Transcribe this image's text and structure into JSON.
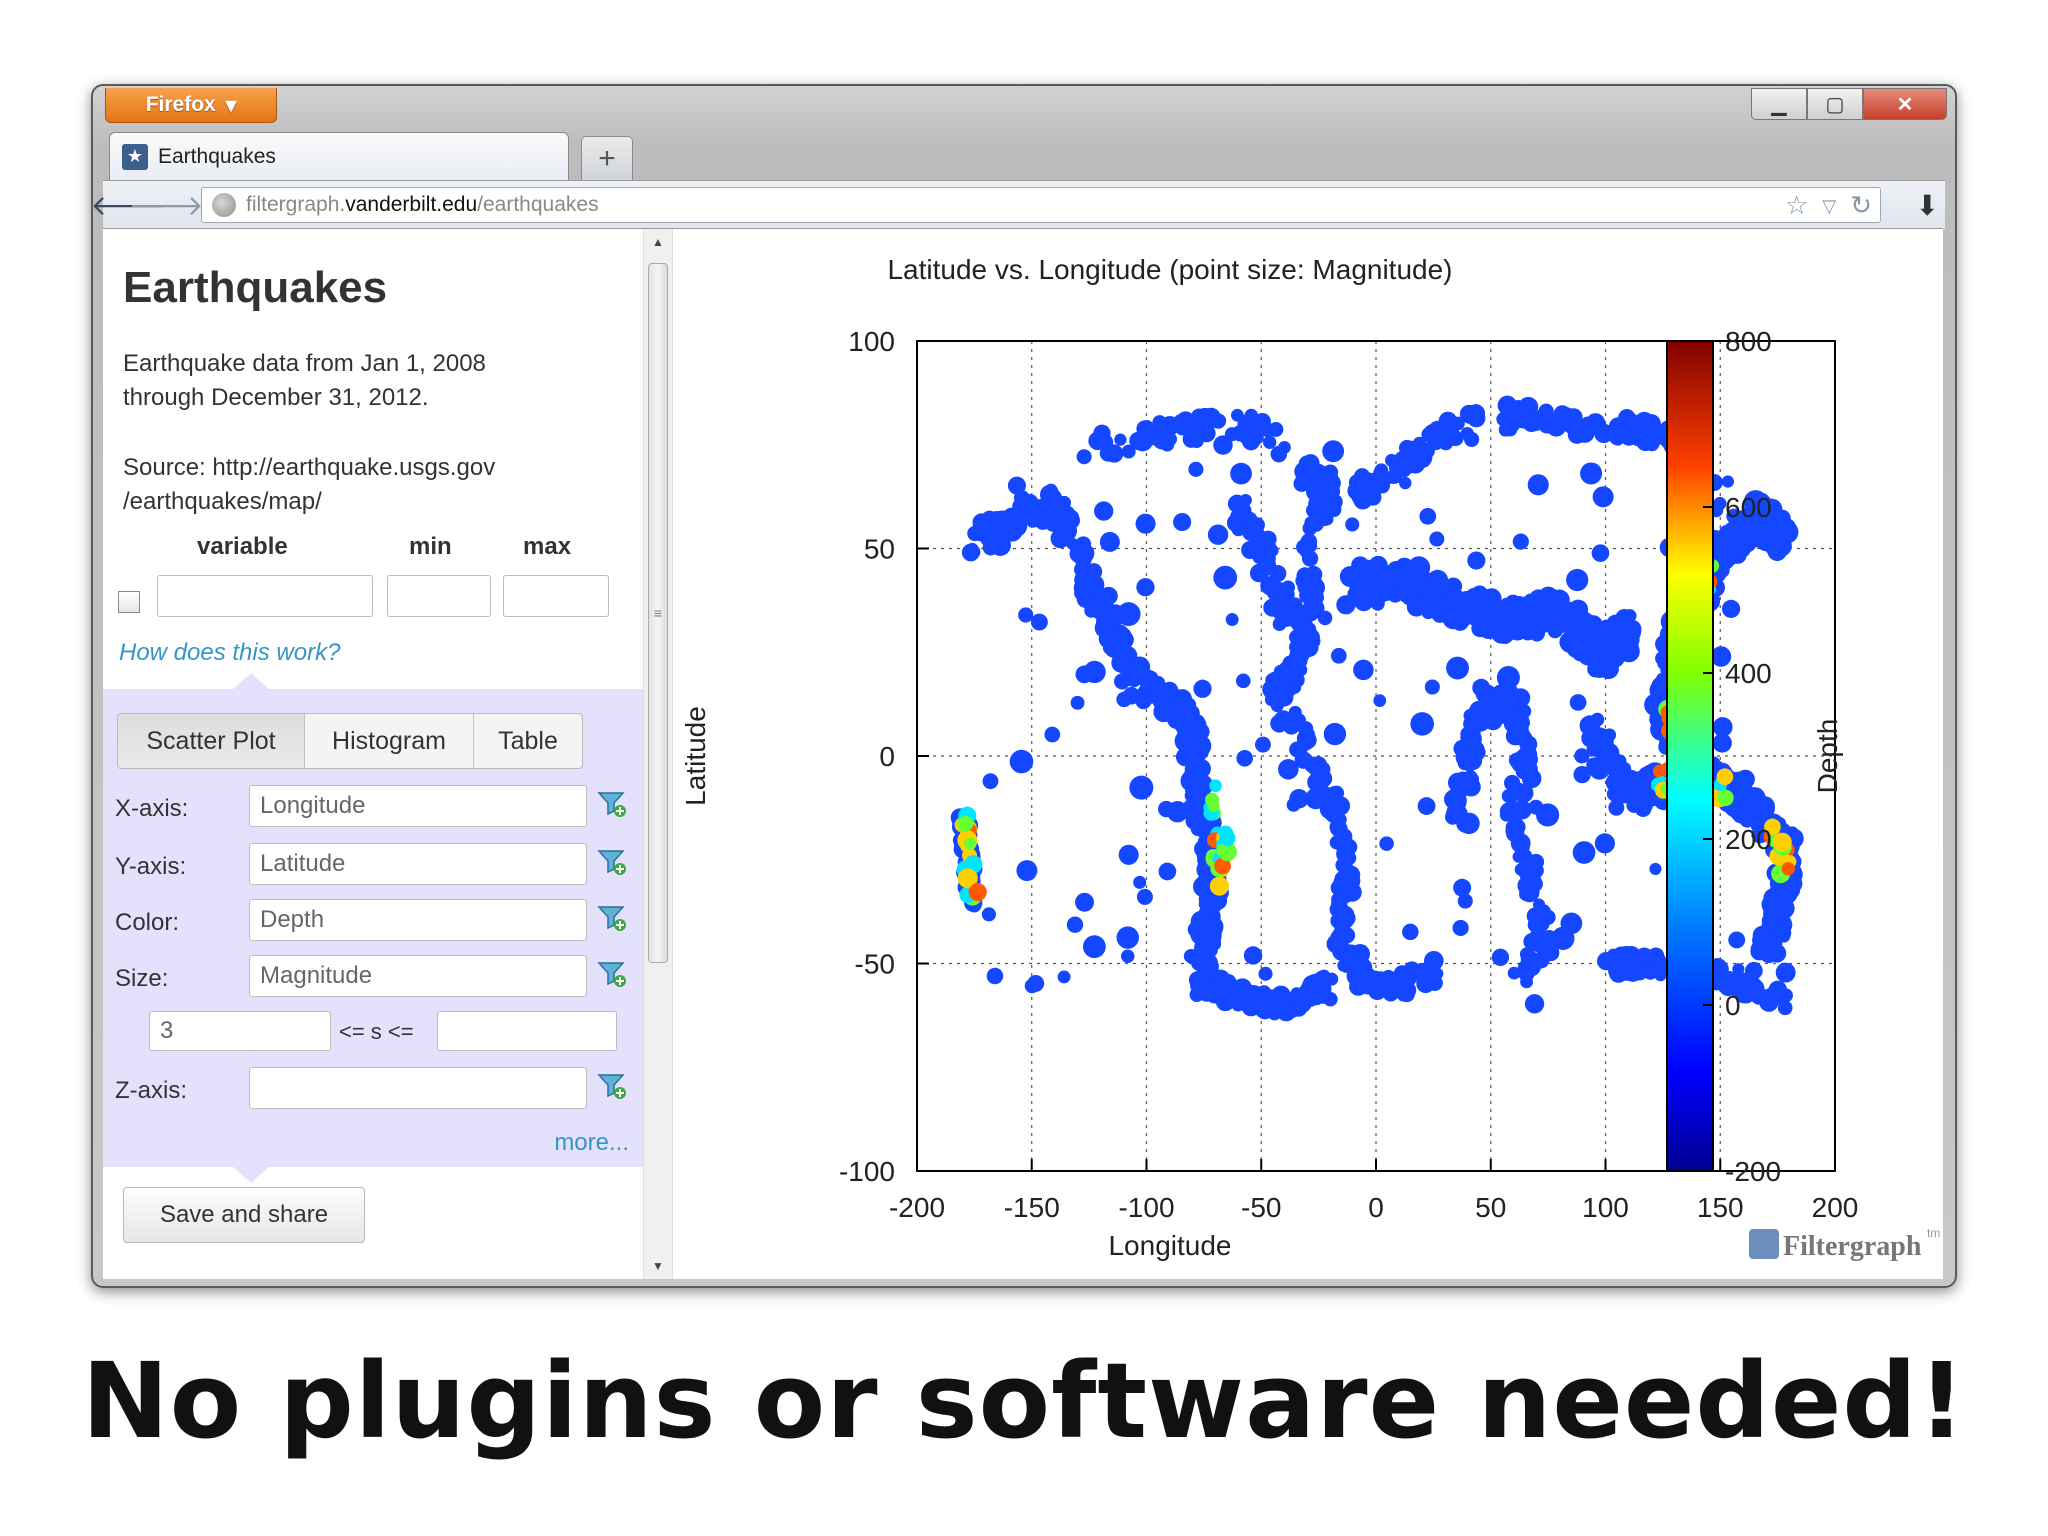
{
  "browser": {
    "app_button": "Firefox",
    "tab_title": "Earthquakes",
    "new_tab": "+",
    "url": {
      "host": "filtergraph.",
      "domain": "vanderbilt.edu",
      "path": "/earthquakes"
    },
    "window_controls": [
      "▁",
      "▢",
      "✕"
    ]
  },
  "sidebar": {
    "title": "Earthquakes",
    "description_line1": "Earthquake data from Jan 1, 2008",
    "description_line2": "through December 31, 2012.",
    "source_line1": "Source: http://earthquake.usgs.gov",
    "source_line2": "/earthquakes/map/",
    "filter_headers": {
      "variable": "variable",
      "min": "min",
      "max": "max"
    },
    "help_link": "How does this work?",
    "tabs": [
      "Scatter Plot",
      "Histogram",
      "Table"
    ],
    "fields": {
      "x_label": "X-axis:",
      "x_value": "Longitude",
      "y_label": "Y-axis:",
      "y_value": "Latitude",
      "color_label": "Color:",
      "color_value": "Depth",
      "size_label": "Size:",
      "size_value": "Magnitude",
      "size_min": "3",
      "size_relation": "<= s <=",
      "z_label": "Z-axis:",
      "z_value": ""
    },
    "more_link": "more...",
    "save_button": "Save and share"
  },
  "chart_data": {
    "type": "scatter",
    "title": "Latitude vs. Longitude (point size: Magnitude)",
    "xlabel": "Longitude",
    "ylabel": "Latitude",
    "xlim": [
      -200,
      200
    ],
    "ylim": [
      -100,
      100
    ],
    "xticks": [
      "-200",
      "-150",
      "-100",
      "-50",
      "0",
      "50",
      "100",
      "150",
      "200"
    ],
    "yticks": [
      "100",
      "50",
      "0",
      "-50",
      "-100"
    ],
    "grid": true,
    "colorbar": {
      "label": "Depth",
      "range": [
        -200,
        800
      ],
      "ticks": [
        "800",
        "600",
        "400",
        "200",
        "0",
        "-200"
      ]
    },
    "point_color": "#1447ff",
    "deep_colors": [
      "#00e5ff",
      "#66ff33",
      "#ffd000",
      "#ff5a00"
    ],
    "point_sets_description_free": true
  },
  "branding": {
    "name": "Filtergraph",
    "tm": "tm"
  },
  "footer": {
    "message": "No plugins or software needed!"
  }
}
